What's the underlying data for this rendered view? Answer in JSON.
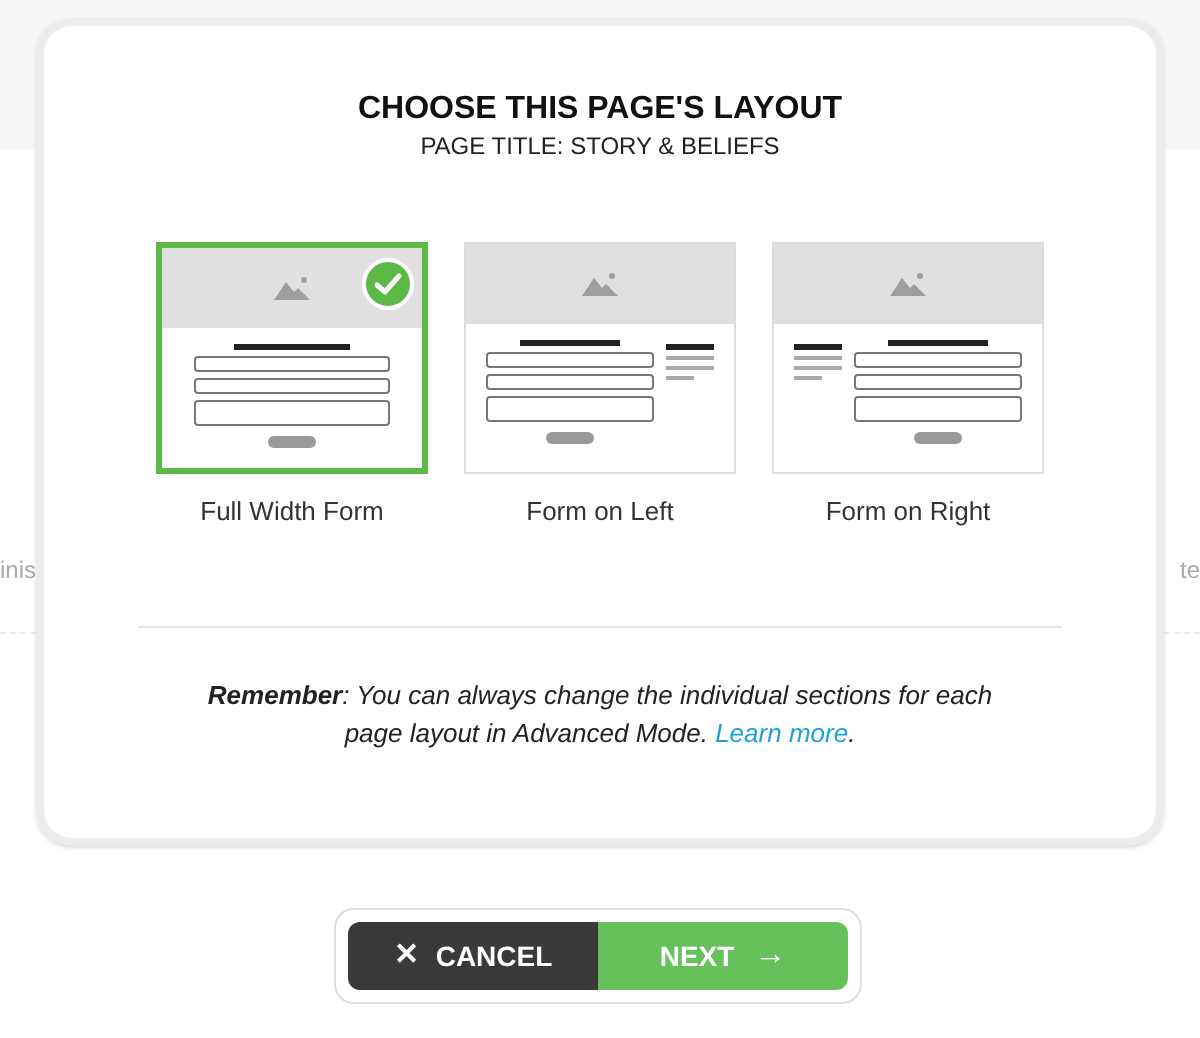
{
  "background_left_text": "inis",
  "background_right_text": "te",
  "dialog": {
    "title": "CHOOSE THIS PAGE'S LAYOUT",
    "subtitle": "PAGE TITLE: STORY & BELIEFS",
    "layouts": [
      {
        "label": "Full Width Form",
        "kind": "full",
        "selected": true
      },
      {
        "label": "Form on Left",
        "kind": "left",
        "selected": false
      },
      {
        "label": "Form on Right",
        "kind": "right",
        "selected": false
      }
    ],
    "note": {
      "text": "**Remember**: You can always change the individual sections for each page layout in Advanced Mode. ",
      "link": "Learn more",
      "end": "."
    }
  },
  "buttons": {
    "cancel": {
      "icon": "✕",
      "label": "CANCEL"
    },
    "next": {
      "label": "NEXT",
      "icon": "→"
    }
  }
}
